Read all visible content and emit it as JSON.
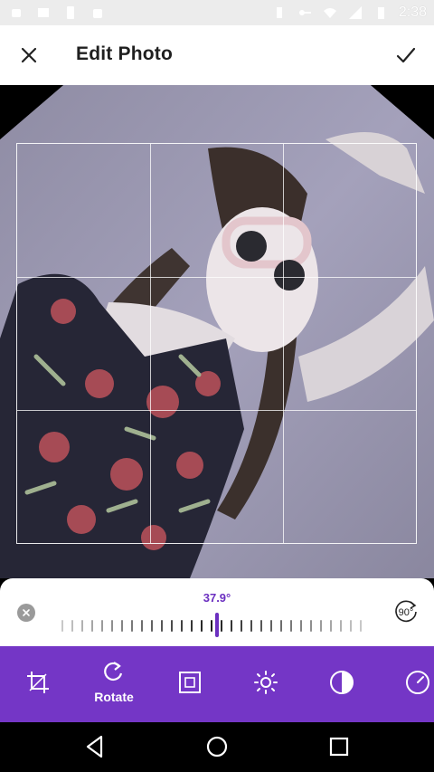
{
  "status_bar": {
    "time": "2:38"
  },
  "header": {
    "title": "Edit Photo"
  },
  "rotate": {
    "angle_label": "37.9°",
    "angle_value": 37.9,
    "rotate90_label": "90°"
  },
  "toolbar": {
    "tools": [
      {
        "name": "crop",
        "label": ""
      },
      {
        "name": "rotate",
        "label": "Rotate"
      },
      {
        "name": "scale",
        "label": ""
      },
      {
        "name": "brightness",
        "label": ""
      },
      {
        "name": "contrast",
        "label": ""
      },
      {
        "name": "more",
        "label": ""
      }
    ],
    "active_label": "Rotate"
  },
  "colors": {
    "accent": "#7436c6",
    "accent_text": "#6b2fc0",
    "panel": "#ffffff",
    "backdrop": "#000000"
  }
}
